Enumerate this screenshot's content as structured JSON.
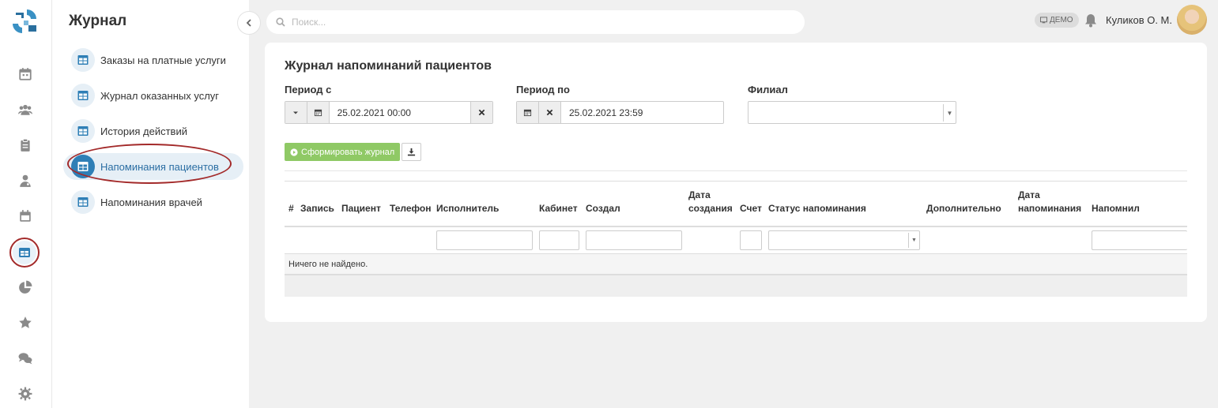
{
  "search": {
    "placeholder": "Поиск..."
  },
  "header": {
    "demo_badge": "ДЕМО",
    "user_name": "Куликов О. М."
  },
  "submenu": {
    "title": "Журнал",
    "items": [
      {
        "label": "Заказы на платные услуги"
      },
      {
        "label": "Журнал оказанных услуг"
      },
      {
        "label": "История действий"
      },
      {
        "label": "Напоминания пациентов"
      },
      {
        "label": "Напоминания врачей"
      }
    ]
  },
  "rail": {
    "icons": [
      "calendar-icon",
      "users-icon",
      "clipboard-icon",
      "doctor-icon",
      "calendar-alt-icon",
      "journal-icon",
      "pie-chart-icon",
      "star-icon",
      "chat-icon",
      "settings-icon"
    ],
    "active": "journal-icon"
  },
  "main": {
    "title": "Журнал напоминаний пациентов",
    "period_from": {
      "label": "Период с",
      "value": "25.02.2021 00:00"
    },
    "period_to": {
      "label": "Период по",
      "value": "25.02.2021 23:59"
    },
    "branch": {
      "label": "Филиал",
      "value": ""
    },
    "generate_button": "Сформировать журнал"
  },
  "table": {
    "columns": [
      {
        "label": "#"
      },
      {
        "label": "Запись"
      },
      {
        "label": "Пациент"
      },
      {
        "label": "Телефон"
      },
      {
        "label": "Исполнитель"
      },
      {
        "label": "Кабинет"
      },
      {
        "label": "Создал"
      },
      {
        "label": "Дата\nсоздания"
      },
      {
        "label": "Счет"
      },
      {
        "label": "Статус напоминания"
      },
      {
        "label": "Дополнительно"
      },
      {
        "label": "Дата\nнапоминания"
      },
      {
        "label": "Напомнил"
      }
    ],
    "empty_text": "Ничего не найдено."
  },
  "colors": {
    "accent": "#2f7fb6",
    "generate": "#8fc965",
    "highlight": "#a32a2a"
  }
}
